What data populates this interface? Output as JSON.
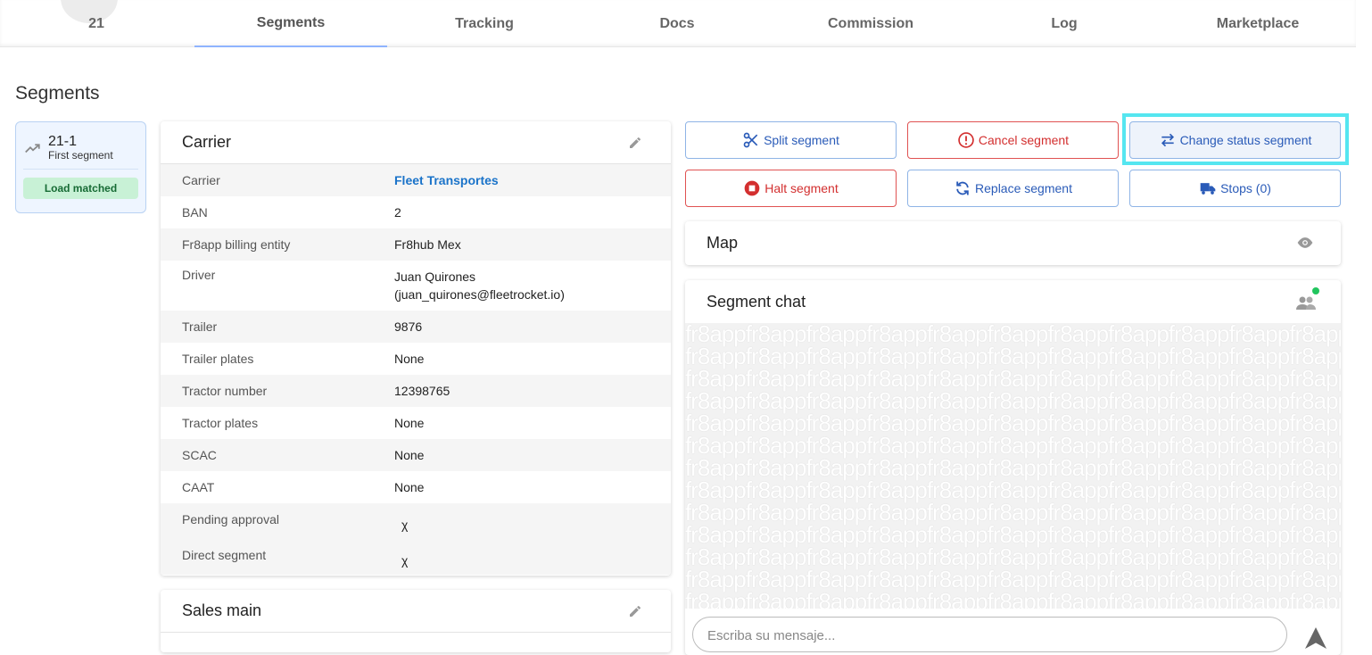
{
  "tabs": [
    {
      "label": "21"
    },
    {
      "label": "Segments",
      "active": true
    },
    {
      "label": "Tracking"
    },
    {
      "label": "Docs"
    },
    {
      "label": "Commission"
    },
    {
      "label": "Log"
    },
    {
      "label": "Marketplace"
    }
  ],
  "page_title": "Segments",
  "segment_card": {
    "id": "21-1",
    "name": "First segment",
    "badge": "Load matched",
    "icon": "trending-up-icon"
  },
  "carrier": {
    "title": "Carrier",
    "rows": [
      {
        "label": "Carrier",
        "value": "Fleet Transportes"
      },
      {
        "label": "BAN",
        "value": "2"
      },
      {
        "label": "Fr8app billing entity",
        "value": "Fr8hub Mex"
      },
      {
        "label": "Driver",
        "value": "Juan Quirones",
        "value2": "(juan_quirones@fleetrocket.io)"
      },
      {
        "label": "Trailer",
        "value": "9876"
      },
      {
        "label": "Trailer plates",
        "value": "None"
      },
      {
        "label": "Tractor number",
        "value": "12398765"
      },
      {
        "label": "Tractor plates",
        "value": "None"
      },
      {
        "label": "SCAC",
        "value": "None"
      },
      {
        "label": "CAAT",
        "value": "None"
      },
      {
        "label": "Pending approval",
        "value": "χ"
      },
      {
        "label": "Direct segment",
        "value": "χ"
      }
    ]
  },
  "sales_main": {
    "title": "Sales main"
  },
  "actions": {
    "split": "Split segment",
    "cancel": "Cancel segment",
    "change_status": "Change status segment",
    "halt": "Halt segment",
    "replace": "Replace segment",
    "stops": "Stops (0)"
  },
  "map": {
    "title": "Map"
  },
  "chat": {
    "title": "Segment chat",
    "placeholder": "Escriba su mensaje...",
    "watermark": "fr8app"
  },
  "colors": {
    "primary": "#2a5bb8",
    "danger": "#d32f2f",
    "success_bg": "#c8f1d6",
    "online": "#22c55e"
  }
}
